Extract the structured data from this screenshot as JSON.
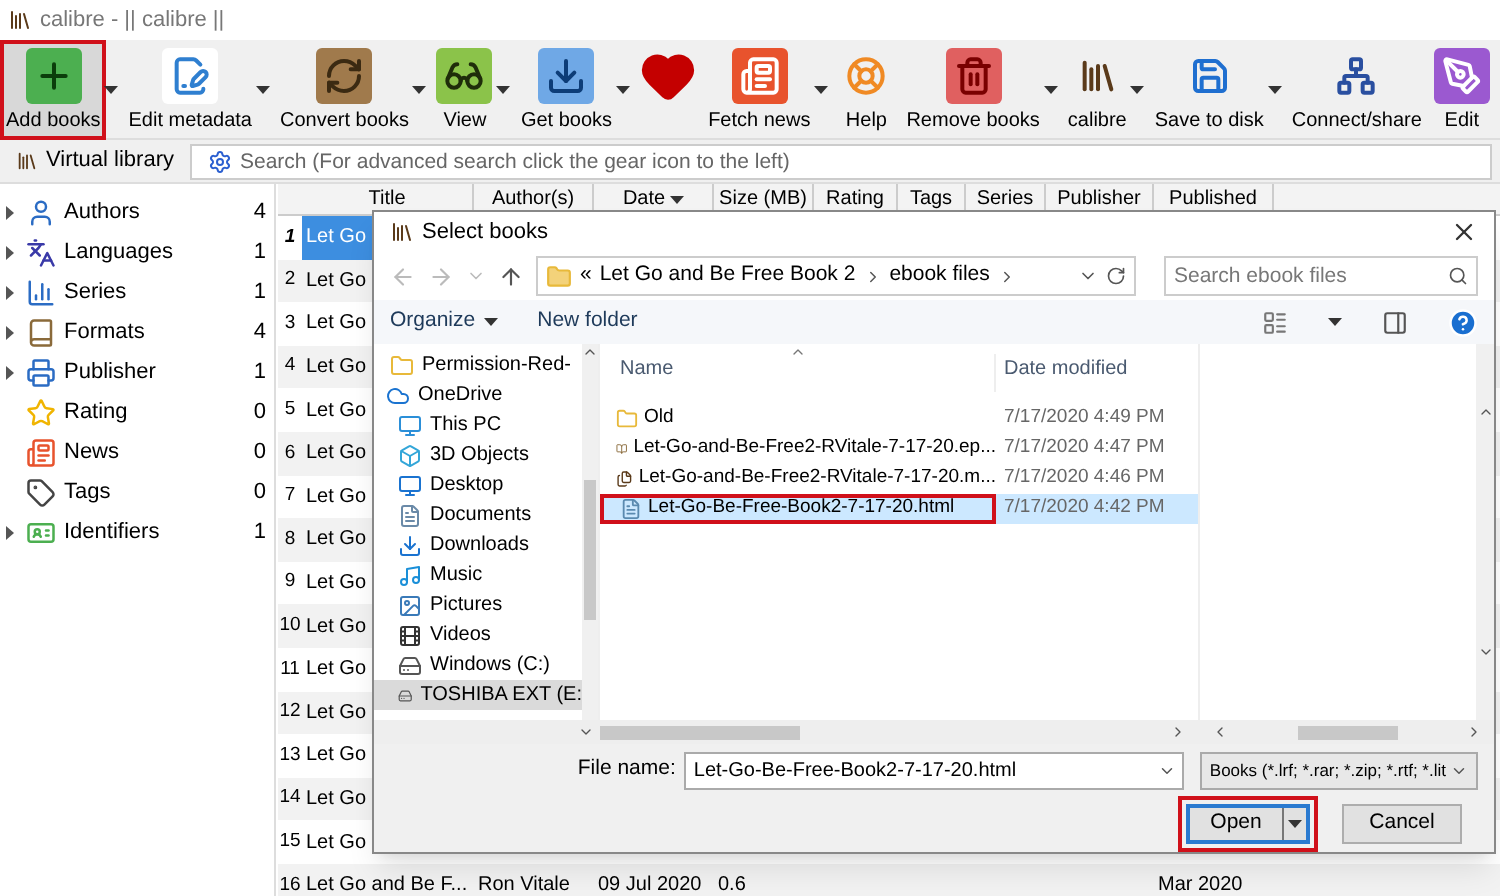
{
  "window": {
    "title": "calibre - || calibre ||"
  },
  "toolbar": [
    {
      "kind": "add",
      "label": "Add books",
      "has_menu": true,
      "selected": true,
      "highlighted": true
    },
    {
      "kind": "edit_metadata",
      "label": "Edit metadata",
      "has_menu": true,
      "selected": false,
      "highlighted": false
    },
    {
      "kind": "convert",
      "label": "Convert books",
      "has_menu": true,
      "selected": false,
      "highlighted": false
    },
    {
      "kind": "view",
      "label": "View",
      "has_menu": true,
      "selected": false,
      "highlighted": false
    },
    {
      "kind": "get",
      "label": "Get books",
      "has_menu": true,
      "selected": false,
      "highlighted": false
    },
    {
      "kind": "donate",
      "has_menu": false,
      "selected": false,
      "highlighted": false
    },
    {
      "kind": "news",
      "label": "Fetch news",
      "has_menu": true,
      "selected": false,
      "highlighted": false
    },
    {
      "kind": "help",
      "label": "Help",
      "has_menu": false,
      "selected": false,
      "highlighted": false
    },
    {
      "kind": "remove",
      "label": "Remove books",
      "has_menu": true,
      "selected": false,
      "highlighted": false
    },
    {
      "kind": "library",
      "label": "calibre",
      "has_menu": true,
      "selected": false,
      "highlighted": false
    },
    {
      "kind": "save",
      "label": "Save to disk",
      "has_menu": true,
      "selected": false,
      "highlighted": false
    },
    {
      "kind": "connect",
      "label": "Connect/share",
      "has_menu": false,
      "selected": false,
      "highlighted": false
    },
    {
      "kind": "edit_book",
      "label": "Edit",
      "has_menu": false,
      "selected": false,
      "highlighted": false
    }
  ],
  "virtual_library": "Virtual library",
  "search": {
    "placeholder": "Search (For advanced search click the gear icon to the left)"
  },
  "sidebar": {
    "items": [
      {
        "kind": "authors",
        "label": "Authors",
        "count": "4",
        "expandable": true
      },
      {
        "kind": "languages",
        "label": "Languages",
        "count": "1",
        "expandable": true
      },
      {
        "kind": "series",
        "label": "Series",
        "count": "1",
        "expandable": true
      },
      {
        "kind": "formats",
        "label": "Formats",
        "count": "4",
        "expandable": true
      },
      {
        "kind": "publisher",
        "label": "Publisher",
        "count": "1",
        "expandable": true
      },
      {
        "kind": "rating",
        "label": "Rating",
        "count": "0",
        "expandable": false
      },
      {
        "kind": "news",
        "label": "News",
        "count": "0",
        "expandable": false
      },
      {
        "kind": "tags",
        "label": "Tags",
        "count": "0",
        "expandable": false
      },
      {
        "kind": "identifiers",
        "label": "Identifiers",
        "count": "1",
        "expandable": true
      }
    ]
  },
  "table": {
    "columns": [
      {
        "label": "Title",
        "sorted": false
      },
      {
        "label": "Author(s)",
        "sorted": false
      },
      {
        "label": "Date",
        "sorted": true
      },
      {
        "label": "Size (MB)",
        "sorted": false
      },
      {
        "label": "Rating",
        "sorted": false
      },
      {
        "label": "Tags",
        "sorted": false
      },
      {
        "label": "Series",
        "sorted": false
      },
      {
        "label": "Publisher",
        "sorted": false
      },
      {
        "label": "Published",
        "sorted": false
      }
    ],
    "rows": [
      {
        "number": "1",
        "title": "Let Go",
        "selected": true
      },
      {
        "number": "2",
        "title": "Let Go",
        "selected": false
      },
      {
        "number": "3",
        "title": "Let Go",
        "selected": false
      },
      {
        "number": "4",
        "title": "Let Go",
        "selected": false
      },
      {
        "number": "5",
        "title": "Let Go",
        "selected": false
      },
      {
        "number": "6",
        "title": "Let Go",
        "selected": false
      },
      {
        "number": "7",
        "title": "Let Go",
        "selected": false
      },
      {
        "number": "8",
        "title": "Let Go",
        "selected": false
      },
      {
        "number": "9",
        "title": "Let Go",
        "selected": false
      },
      {
        "number": "10",
        "title": "Let Go",
        "selected": false
      },
      {
        "number": "11",
        "title": "Let Go",
        "selected": false
      },
      {
        "number": "12",
        "title": "Let Go",
        "selected": false
      },
      {
        "number": "13",
        "title": "Let Go",
        "selected": false
      },
      {
        "number": "14",
        "title": "Let Go",
        "selected": false
      },
      {
        "number": "15",
        "title": "Let Go",
        "selected": false
      },
      {
        "number": "16",
        "title": "Let Go and Be F...",
        "authors": "Ron Vitale",
        "date": "09 Jul 2020",
        "size": "0.6",
        "published": "Mar 2020",
        "selected": false
      }
    ]
  },
  "dialog": {
    "title": "Select books",
    "address_prefix": "«",
    "path": [
      "Let Go and Be Free Book 2",
      "ebook files"
    ],
    "search_placeholder": "Search ebook files",
    "organize": "Organize",
    "new_folder": "New folder",
    "nav": [
      {
        "kind": "folder",
        "label": "Permission-Red-",
        "selected": false
      },
      {
        "kind": "cloud",
        "label": "OneDrive",
        "selected": false
      },
      {
        "kind": "pc",
        "label": "This PC",
        "selected": false
      },
      {
        "kind": "objects",
        "label": "3D Objects",
        "selected": false
      },
      {
        "kind": "desktop",
        "label": "Desktop",
        "selected": false
      },
      {
        "kind": "documents",
        "label": "Documents",
        "selected": false
      },
      {
        "kind": "downloads",
        "label": "Downloads",
        "selected": false
      },
      {
        "kind": "music",
        "label": "Music",
        "selected": false
      },
      {
        "kind": "pictures",
        "label": "Pictures",
        "selected": false
      },
      {
        "kind": "videos",
        "label": "Videos",
        "selected": false
      },
      {
        "kind": "drive",
        "label": "Windows (C:)",
        "selected": false
      },
      {
        "kind": "drive",
        "label": "TOSHIBA EXT (E:",
        "selected": true
      }
    ],
    "columns": [
      "Name",
      "Date modified"
    ],
    "files": [
      {
        "kind": "folder",
        "name": "Old",
        "date": "7/17/2020 4:49 PM",
        "selected": false,
        "highlighted": false
      },
      {
        "kind": "ebook",
        "name": "Let-Go-and-Be-Free2-RVitale-7-17-20.ep...",
        "date": "7/17/2020 4:47 PM",
        "selected": false,
        "highlighted": false
      },
      {
        "kind": "library",
        "name": "Let-Go-and-Be-Free2-RVitale-7-17-20.m...",
        "date": "7/17/2020 4:46 PM",
        "selected": false,
        "highlighted": false
      },
      {
        "kind": "html",
        "name": "Let-Go-Be-Free-Book2-7-17-20.html",
        "date": "7/17/2020 4:42 PM",
        "selected": true,
        "highlighted": true
      }
    ],
    "file_name": {
      "label": "File name:",
      "value": "Let-Go-Be-Free-Book2-7-17-20.html"
    },
    "file_type": "Books (*.lrf; *.rar; *.zip; *.rtf; *.lit",
    "buttons": [
      {
        "kind": "split",
        "label": "Open",
        "highlighted": true
      },
      {
        "kind": "plain",
        "label": "Cancel",
        "highlighted": false
      }
    ]
  }
}
